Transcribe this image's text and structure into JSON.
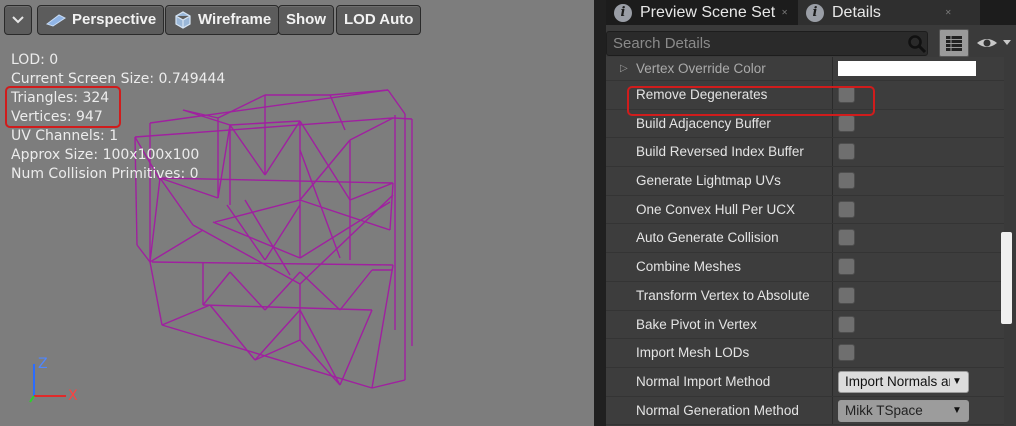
{
  "viewport": {
    "menu_icon": "chevron-down-icon",
    "toolbar": {
      "perspective_label": "Perspective",
      "perspective_icon": "perspective-view-icon",
      "wireframe_label": "Wireframe",
      "wireframe_icon": "wireframe-cube-icon",
      "show_label": "Show",
      "lod_label": "LOD Auto"
    },
    "stats": {
      "lod": "LOD:  0",
      "screen_size": "Current Screen Size:  0.749444",
      "triangles": "Triangles:  324",
      "vertices": "Vertices:  947",
      "uv_channels": "UV Channels:  1",
      "approx_size": "Approx Size: 100x100x100",
      "collision": "Num Collision Primitives:  0"
    },
    "axis": {
      "z": "Z",
      "x": "X"
    },
    "highlight_color": "#d01c1c",
    "mesh_color": "#a020a0"
  },
  "panel": {
    "tabs": [
      {
        "label": "Preview Scene Set",
        "icon": "info-icon"
      },
      {
        "label": "Details",
        "icon": "info-icon"
      }
    ],
    "search_placeholder": "Search Details",
    "search_icon": "search-icon",
    "grid_icon": "grid-view-icon",
    "eye_icon": "eye-icon",
    "rows": [
      {
        "label": "Vertex Override Color",
        "type": "color",
        "value": "#ffffff"
      },
      {
        "label": "Remove Degenerates",
        "type": "checkbox",
        "checked": false
      },
      {
        "label": "Build Adjacency Buffer",
        "type": "checkbox",
        "checked": false
      },
      {
        "label": "Build Reversed Index Buffer",
        "type": "checkbox",
        "checked": false
      },
      {
        "label": "Generate Lightmap UVs",
        "type": "checkbox",
        "checked": false
      },
      {
        "label": "One Convex Hull Per UCX",
        "type": "checkbox",
        "checked": false
      },
      {
        "label": "Auto Generate Collision",
        "type": "checkbox",
        "checked": false
      },
      {
        "label": "Combine Meshes",
        "type": "checkbox",
        "checked": false
      },
      {
        "label": "Transform Vertex to Absolute",
        "type": "checkbox",
        "checked": false
      },
      {
        "label": "Bake Pivot in Vertex",
        "type": "checkbox",
        "checked": false
      },
      {
        "label": "Import Mesh LODs",
        "type": "checkbox",
        "checked": false
      },
      {
        "label": "Normal Import Method",
        "type": "dropdown",
        "value": "Import Normals ar"
      },
      {
        "label": "Normal Generation Method",
        "type": "dropdown",
        "value": "Mikk TSpace",
        "disabled": true
      }
    ]
  }
}
